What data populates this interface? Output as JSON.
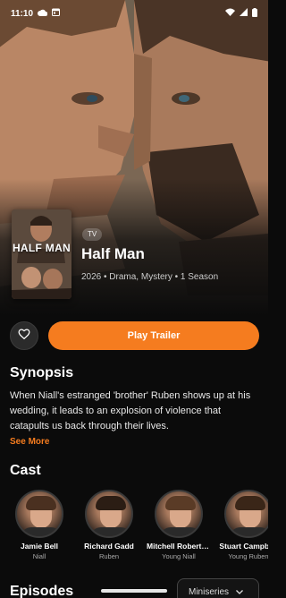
{
  "status_bar": {
    "time": "11:10"
  },
  "show": {
    "poster_title": "HALF MAN",
    "type_badge": "TV",
    "title": "Half Man",
    "meta": "2026 • Drama, Mystery • 1 Season"
  },
  "actions": {
    "play_label": "Play Trailer"
  },
  "synopsis": {
    "heading": "Synopsis",
    "text": "When Niall's estranged 'brother' Ruben shows up at his wedding, it leads to an explosion of violence that catapults us back through their lives.",
    "see_more": "See More"
  },
  "cast": {
    "heading": "Cast",
    "members": [
      {
        "name": "Jamie Bell",
        "role": "Niall"
      },
      {
        "name": "Richard Gadd",
        "role": "Ruben"
      },
      {
        "name": "Mitchell Robertson",
        "role": "Young Niall"
      },
      {
        "name": "Stuart Campbell",
        "role": "Young Ruben"
      }
    ]
  },
  "episodes": {
    "heading": "Episodes",
    "season_select": "Miniseries"
  },
  "colors": {
    "accent": "#f57c1f",
    "background": "#0b0b0b"
  },
  "icons": [
    "cloud-icon",
    "calendar-icon",
    "wifi-icon",
    "signal-icon",
    "battery-icon",
    "heart-icon",
    "chevron-down-icon"
  ]
}
